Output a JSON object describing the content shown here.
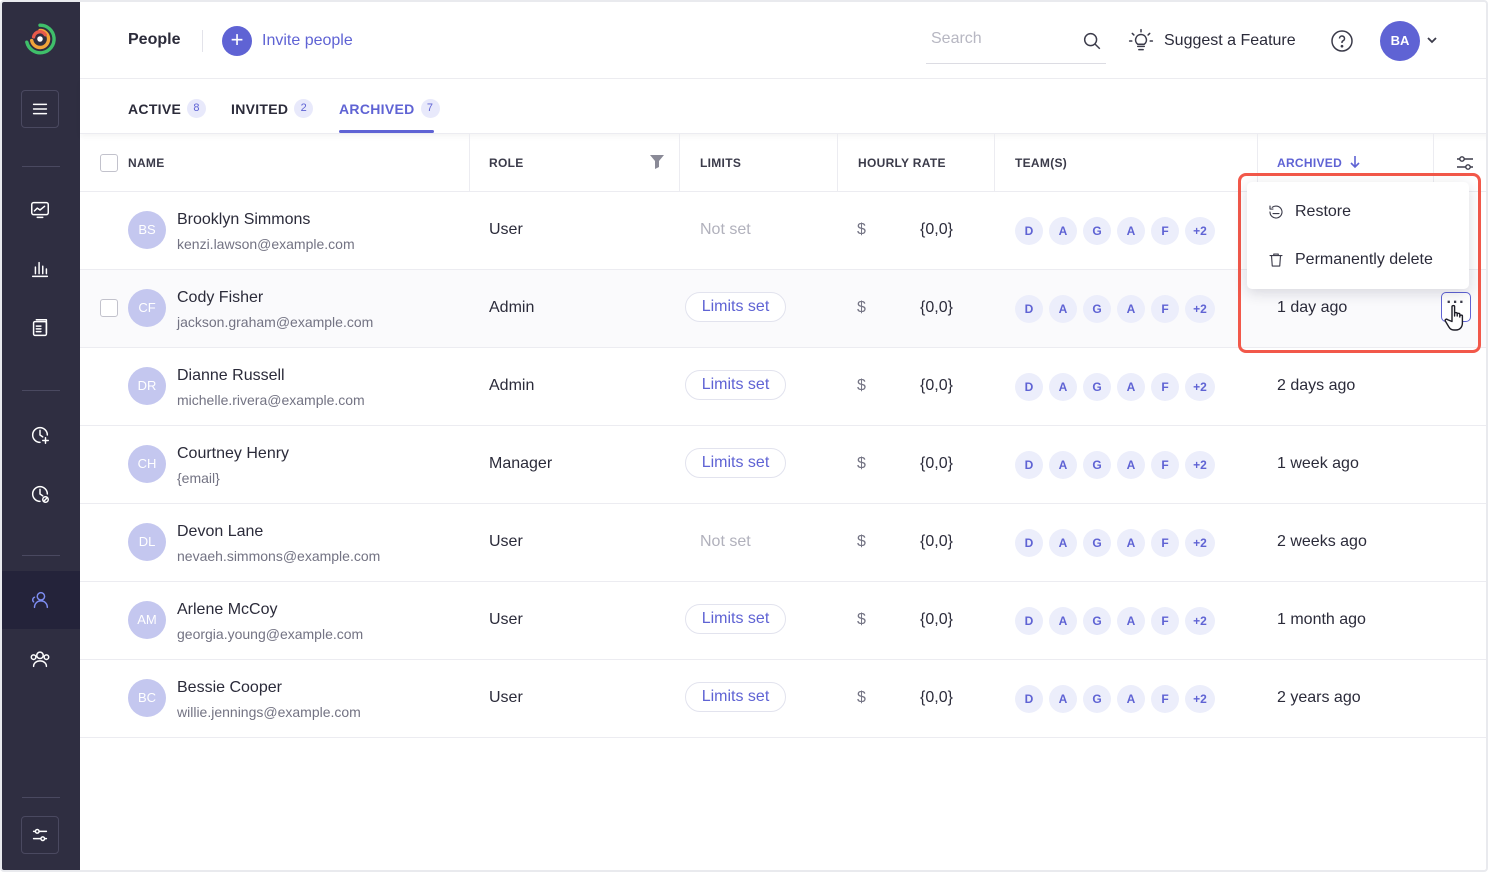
{
  "header": {
    "title": "People",
    "invite_label": "Invite people",
    "search_placeholder": "Search",
    "suggest_label": "Suggest a Feature",
    "avatar_initials": "BA"
  },
  "tabs": [
    {
      "label": "ACTIVE",
      "count": "8"
    },
    {
      "label": "INVITED",
      "count": "2"
    },
    {
      "label": "ARCHIVED",
      "count": "7"
    }
  ],
  "columns": {
    "name": "NAME",
    "role": "ROLE",
    "limits": "LIMITS",
    "hourly_rate": "HOURLY RATE",
    "teams": "TEAM(S)",
    "archived": "ARCHIVED"
  },
  "menu": {
    "restore": "Restore",
    "delete": "Permanently delete"
  },
  "rows": [
    {
      "initials": "BS",
      "name": "Brooklyn Simmons",
      "email": "kenzi.lawson@example.com",
      "role": "User",
      "limits": "Not set",
      "currency": "$",
      "rate": "{0,0}",
      "teams": [
        "D",
        "A",
        "G",
        "A",
        "F",
        "+2"
      ],
      "archived": ""
    },
    {
      "initials": "CF",
      "name": "Cody Fisher",
      "email": "jackson.graham@example.com",
      "role": "Admin",
      "limits": "Limits set",
      "currency": "$",
      "rate": "{0,0}",
      "teams": [
        "D",
        "A",
        "G",
        "A",
        "F",
        "+2"
      ],
      "archived": "1 day ago"
    },
    {
      "initials": "DR",
      "name": "Dianne Russell",
      "email": "michelle.rivera@example.com",
      "role": "Admin",
      "limits": "Limits set",
      "currency": "$",
      "rate": "{0,0}",
      "teams": [
        "D",
        "A",
        "G",
        "A",
        "F",
        "+2"
      ],
      "archived": "2 days ago"
    },
    {
      "initials": "CH",
      "name": "Courtney Henry",
      "email": "{email}",
      "role": "Manager",
      "limits": "Limits set",
      "currency": "$",
      "rate": "{0,0}",
      "teams": [
        "D",
        "A",
        "G",
        "A",
        "F",
        "+2"
      ],
      "archived": "1 week ago"
    },
    {
      "initials": "DL",
      "name": "Devon Lane",
      "email": "nevaeh.simmons@example.com",
      "role": "User",
      "limits": "Not set",
      "currency": "$",
      "rate": "{0,0}",
      "teams": [
        "D",
        "A",
        "G",
        "A",
        "F",
        "+2"
      ],
      "archived": "2 weeks ago"
    },
    {
      "initials": "AM",
      "name": "Arlene McCoy",
      "email": "georgia.young@example.com",
      "role": "User",
      "limits": "Limits set",
      "currency": "$",
      "rate": "{0,0}",
      "teams": [
        "D",
        "A",
        "G",
        "A",
        "F",
        "+2"
      ],
      "archived": "1 month ago"
    },
    {
      "initials": "BC",
      "name": "Bessie Cooper",
      "email": "willie.jennings@example.com",
      "role": "User",
      "limits": "Limits set",
      "currency": "$",
      "rate": "{0,0}",
      "teams": [
        "D",
        "A",
        "G",
        "A",
        "F",
        "+2"
      ],
      "archived": "2 years ago"
    }
  ],
  "colors": {
    "accent": "#5f63d4",
    "sidebar": "#2f2e41",
    "highlight": "#f2584a"
  }
}
